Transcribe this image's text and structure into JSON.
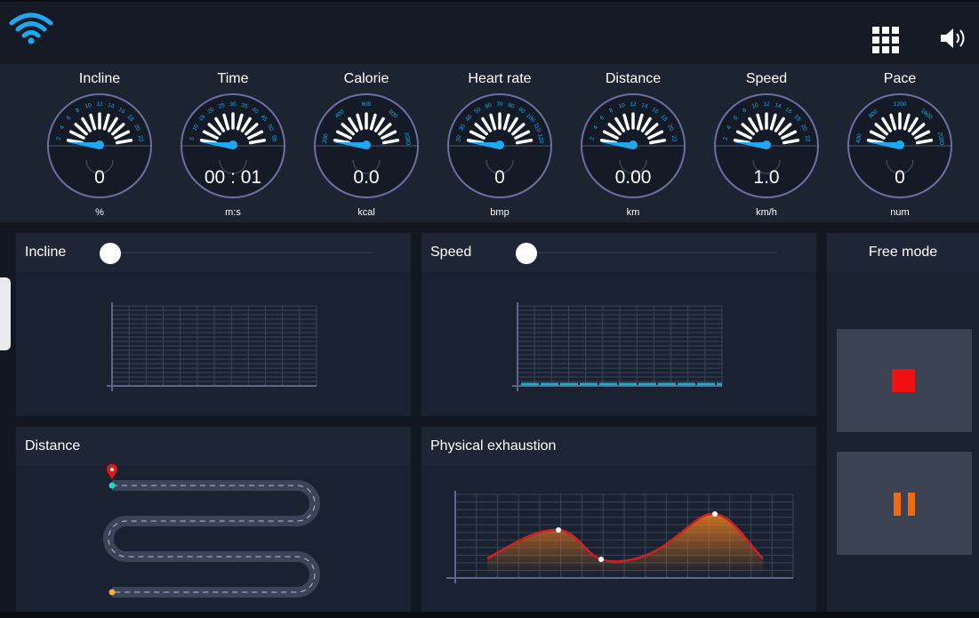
{
  "topbar": {
    "wifi_icon": "wifi-icon",
    "apps_icon": "grid-icon",
    "volume_icon": "speaker-icon"
  },
  "gauges": [
    {
      "label": "Incline",
      "value": "0",
      "unit": "%",
      "ticks": "2 4 6 8 10 12 14 16 18 20 22"
    },
    {
      "label": "Time",
      "value": "00 : 01",
      "unit": "m:s",
      "ticks": "5 10 15 20 25 30 35 40 45 50 55"
    },
    {
      "label": "Calorie",
      "value": "0.0",
      "unit": "kcal",
      "ticks": "200 400 600 800 1000"
    },
    {
      "label": "Heart rate",
      "value": "0",
      "unit": "bmp",
      "ticks": "20 30 40 50 60 70 80 90 100 110 120"
    },
    {
      "label": "Distance",
      "value": "0.00",
      "unit": "km",
      "ticks": "2 4 6 8 10 12 14 16 18 20 22"
    },
    {
      "label": "Speed",
      "value": "1.0",
      "unit": "km/h",
      "ticks": "2 4 6 8 10 12 14 16 18 20 22"
    },
    {
      "label": "Pace",
      "value": "0",
      "unit": "num",
      "ticks": "400 800 1200 1600 2000"
    }
  ],
  "panels": {
    "incline": {
      "title": "Incline",
      "slider_value": 0
    },
    "speed": {
      "title": "Speed",
      "slider_value": 0
    },
    "distance": {
      "title": "Distance"
    },
    "exhaustion": {
      "title": "Physical exhaustion"
    }
  },
  "side": {
    "mode_label": "Free mode",
    "stop_icon": "stop-icon",
    "pause_icon": "pause-icon"
  },
  "colors": {
    "accent": "#1fa8f0",
    "stop": "#f01010",
    "pause": "#f06a10",
    "curve": "#d02020",
    "bg": "#131722"
  }
}
